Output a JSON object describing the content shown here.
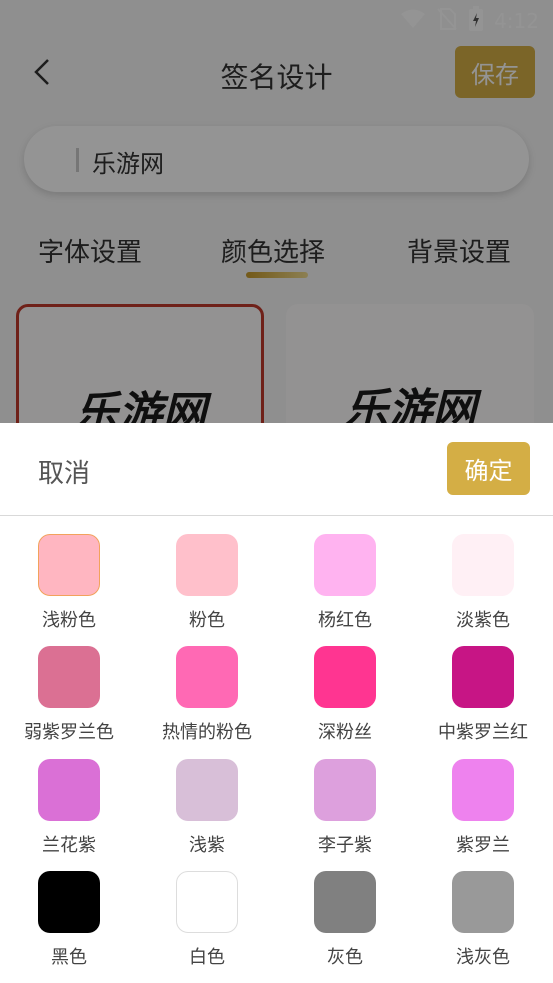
{
  "status_bar": {
    "time": "4:12",
    "icons": [
      "wifi-icon",
      "no-sim-icon",
      "battery-charging-icon"
    ]
  },
  "header": {
    "title": "签名设计",
    "save_label": "保存"
  },
  "name_input": {
    "value": "乐游网"
  },
  "tabs": [
    {
      "label": "字体设置"
    },
    {
      "label": "颜色选择",
      "active": true
    },
    {
      "label": "背景设置"
    }
  ],
  "preview_cards": [
    {
      "text": "乐游网",
      "selected": true
    },
    {
      "text": "乐游网",
      "selected": false
    }
  ],
  "sheet": {
    "cancel_label": "取消",
    "confirm_label": "确定",
    "colors": [
      {
        "name": "浅粉色",
        "hex": "#FFB6C1",
        "selected": true
      },
      {
        "name": "粉色",
        "hex": "#FFC0CB"
      },
      {
        "name": "杨红色",
        "hex": "#FFB3F0"
      },
      {
        "name": "淡紫色",
        "hex": "#FFF0F5"
      },
      {
        "name": "弱紫罗兰色",
        "hex": "#DB7093"
      },
      {
        "name": "热情的粉色",
        "hex": "#FF69B4"
      },
      {
        "name": "深粉丝",
        "hex": "#FF3591"
      },
      {
        "name": "中紫罗兰红",
        "hex": "#C71585"
      },
      {
        "name": "兰花紫",
        "hex": "#DA70D6"
      },
      {
        "name": "浅紫",
        "hex": "#D8BFD8"
      },
      {
        "name": "李子紫",
        "hex": "#DDA0DD"
      },
      {
        "name": "紫罗兰",
        "hex": "#EE82EE"
      },
      {
        "name": "黑色",
        "hex": "#000000"
      },
      {
        "name": "白色",
        "hex": "#FFFFFF"
      },
      {
        "name": "灰色",
        "hex": "#808080"
      },
      {
        "name": "浅灰色",
        "hex": "#999999"
      }
    ]
  },
  "accent_color": "#D4AE45"
}
